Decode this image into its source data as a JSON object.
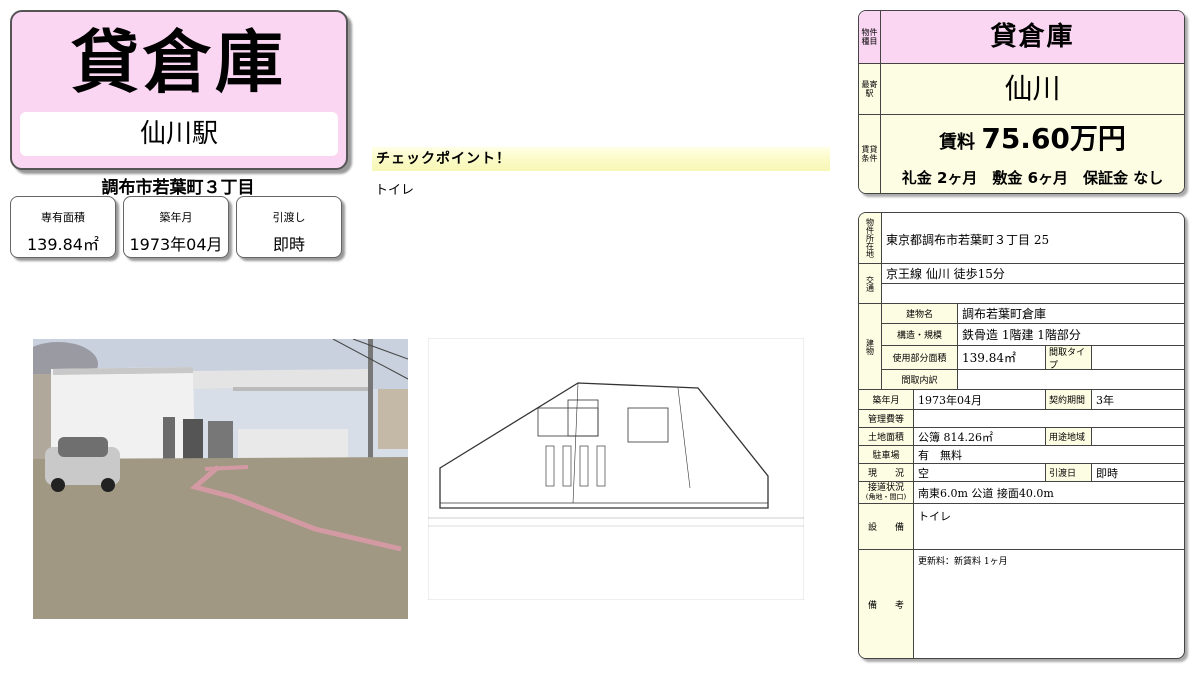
{
  "header": {
    "title": "貸倉庫",
    "station": "仙川駅",
    "address": "調布市若葉町３丁目"
  },
  "cards": [
    {
      "label": "専有面積",
      "value": "139.84㎡"
    },
    {
      "label": "築年月",
      "value": "1973年04月"
    },
    {
      "label": "引渡し",
      "value": "即時"
    }
  ],
  "checkpoint": {
    "heading": "チェックポイント！",
    "text": "トイレ"
  },
  "summary": {
    "type_label": "物件種目",
    "type_value": "貸倉庫",
    "station_label": "最寄駅",
    "station_value": "仙川",
    "terms_label": "賃貸条件",
    "rent_label": "賃料",
    "rent_value": "75.60万円",
    "deposits": "礼金 2ヶ月　敷金 6ヶ月　保証金 なし"
  },
  "details": {
    "location_label": "物件所在地",
    "location": "東京都調布市若葉町３丁目 25",
    "traffic_label": "交通",
    "traffic": "京王線 仙川 徒歩15分",
    "building_label": "建物",
    "building_name_label": "建物名",
    "building_name": "調布若葉町倉庫",
    "structure_label": "構造・規模",
    "structure": "鉄骨造 1階建 1階部分",
    "area_label": "使用部分面積",
    "area": "139.84㎡",
    "layout_type_label": "間取タイプ",
    "layout_label": "間取内訳",
    "built_label": "築年月",
    "built": "1973年04月",
    "contract_label": "契約期間",
    "contract": "3年",
    "mgmt_label": "管理費等",
    "land_label": "土地面積",
    "land": "公簿 814.26㎡",
    "zoning_label": "用途地域",
    "parking_label": "駐車場",
    "parking": "有　無料",
    "status_label": "現　　況",
    "status": "空",
    "handover_label": "引渡日",
    "handover": "即時",
    "road_label": "接道状況",
    "road_sub": "(角地・間口)",
    "road": "南東6.0m 公道 接面40.0m",
    "equip_label": "設　　備",
    "equip": "トイレ",
    "notes_label": "備　　考",
    "notes": "更新料：新賃料 1ヶ月"
  },
  "colors": {
    "pink": "#fbd6f3",
    "cream": "#fdfde3",
    "highlight": "#f7f7b4"
  }
}
